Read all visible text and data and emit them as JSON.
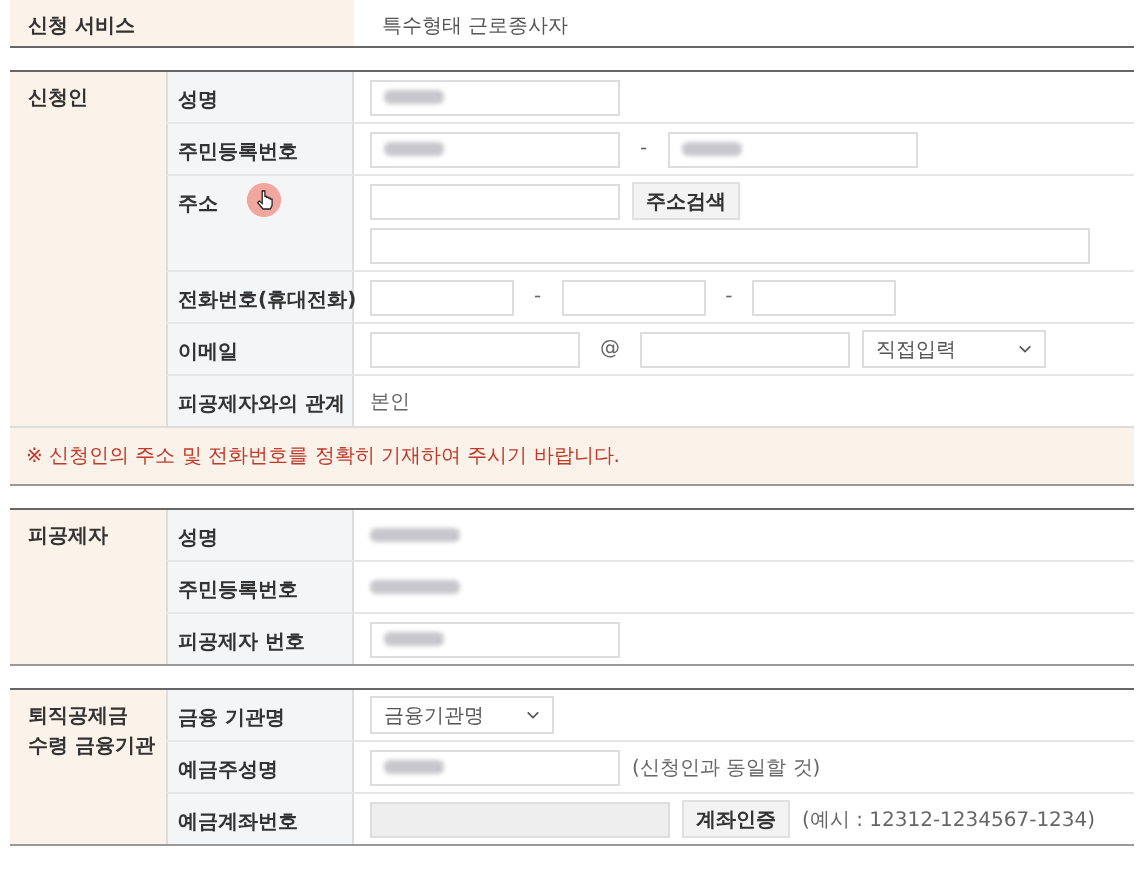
{
  "service": {
    "label": "신청 서비스",
    "value": "특수형태 근로종사자"
  },
  "sections": [
    {
      "title": [
        "신청인"
      ],
      "rows": [
        {
          "label": "성명",
          "pointer": false,
          "lines": [
            [
              {
                "kind": "maskedinput"
              }
            ]
          ]
        },
        {
          "label": "주민등록번호",
          "pointer": false,
          "lines": [
            [
              {
                "kind": "maskedinput"
              },
              {
                "kind": "sep",
                "text": "-"
              },
              {
                "kind": "maskedinput"
              }
            ]
          ]
        },
        {
          "label": "주소",
          "pointer": true,
          "lines": [
            [
              {
                "kind": "input"
              },
              {
                "kind": "button",
                "text": "주소검색"
              }
            ],
            [
              {
                "kind": "longinput"
              }
            ]
          ]
        },
        {
          "label": "전화번호(휴대전화)",
          "pointer": false,
          "lines": [
            [
              {
                "kind": "phoneinput"
              },
              {
                "kind": "sep",
                "text": "-"
              },
              {
                "kind": "phoneinput"
              },
              {
                "kind": "sep",
                "text": "-"
              },
              {
                "kind": "phoneinput"
              }
            ]
          ]
        },
        {
          "label": "이메일",
          "pointer": false,
          "lines": [
            [
              {
                "kind": "emailinput"
              },
              {
                "kind": "sep",
                "text": "@"
              },
              {
                "kind": "emailinput"
              },
              {
                "kind": "select",
                "text": "직접입력"
              }
            ]
          ]
        },
        {
          "label": "피공제자와의 관계",
          "pointer": false,
          "lines": [
            [
              {
                "kind": "text",
                "text": "본인"
              }
            ]
          ]
        }
      ],
      "notice": "※ 신청인의 주소 및 전화번호를 정확히 기재하여 주시기 바랍니다."
    },
    {
      "title": [
        "피공제자"
      ],
      "rows": [
        {
          "label": "성명",
          "pointer": false,
          "lines": [
            [
              {
                "kind": "maskedtext"
              }
            ]
          ]
        },
        {
          "label": "주민등록번호",
          "pointer": false,
          "lines": [
            [
              {
                "kind": "maskedtext"
              }
            ]
          ]
        },
        {
          "label": "피공제자 번호",
          "pointer": false,
          "lines": [
            [
              {
                "kind": "maskedinput"
              }
            ]
          ]
        }
      ]
    },
    {
      "title": [
        "퇴직공제금",
        "수령 금융기관"
      ],
      "rows": [
        {
          "label": "금융 기관명",
          "pointer": false,
          "lines": [
            [
              {
                "kind": "select",
                "text": "금융기관명"
              }
            ]
          ]
        },
        {
          "label": "예금주성명",
          "pointer": false,
          "lines": [
            [
              {
                "kind": "maskedinput"
              },
              {
                "kind": "text",
                "text": "(신청인과 동일할 것)"
              }
            ]
          ]
        },
        {
          "label": "예금계좌번호",
          "pointer": false,
          "lines": [
            [
              {
                "kind": "accountinput"
              },
              {
                "kind": "button",
                "text": "계좌인증"
              },
              {
                "kind": "text",
                "text": "(예시 : 12312-1234567-1234)"
              }
            ]
          ]
        }
      ]
    }
  ]
}
